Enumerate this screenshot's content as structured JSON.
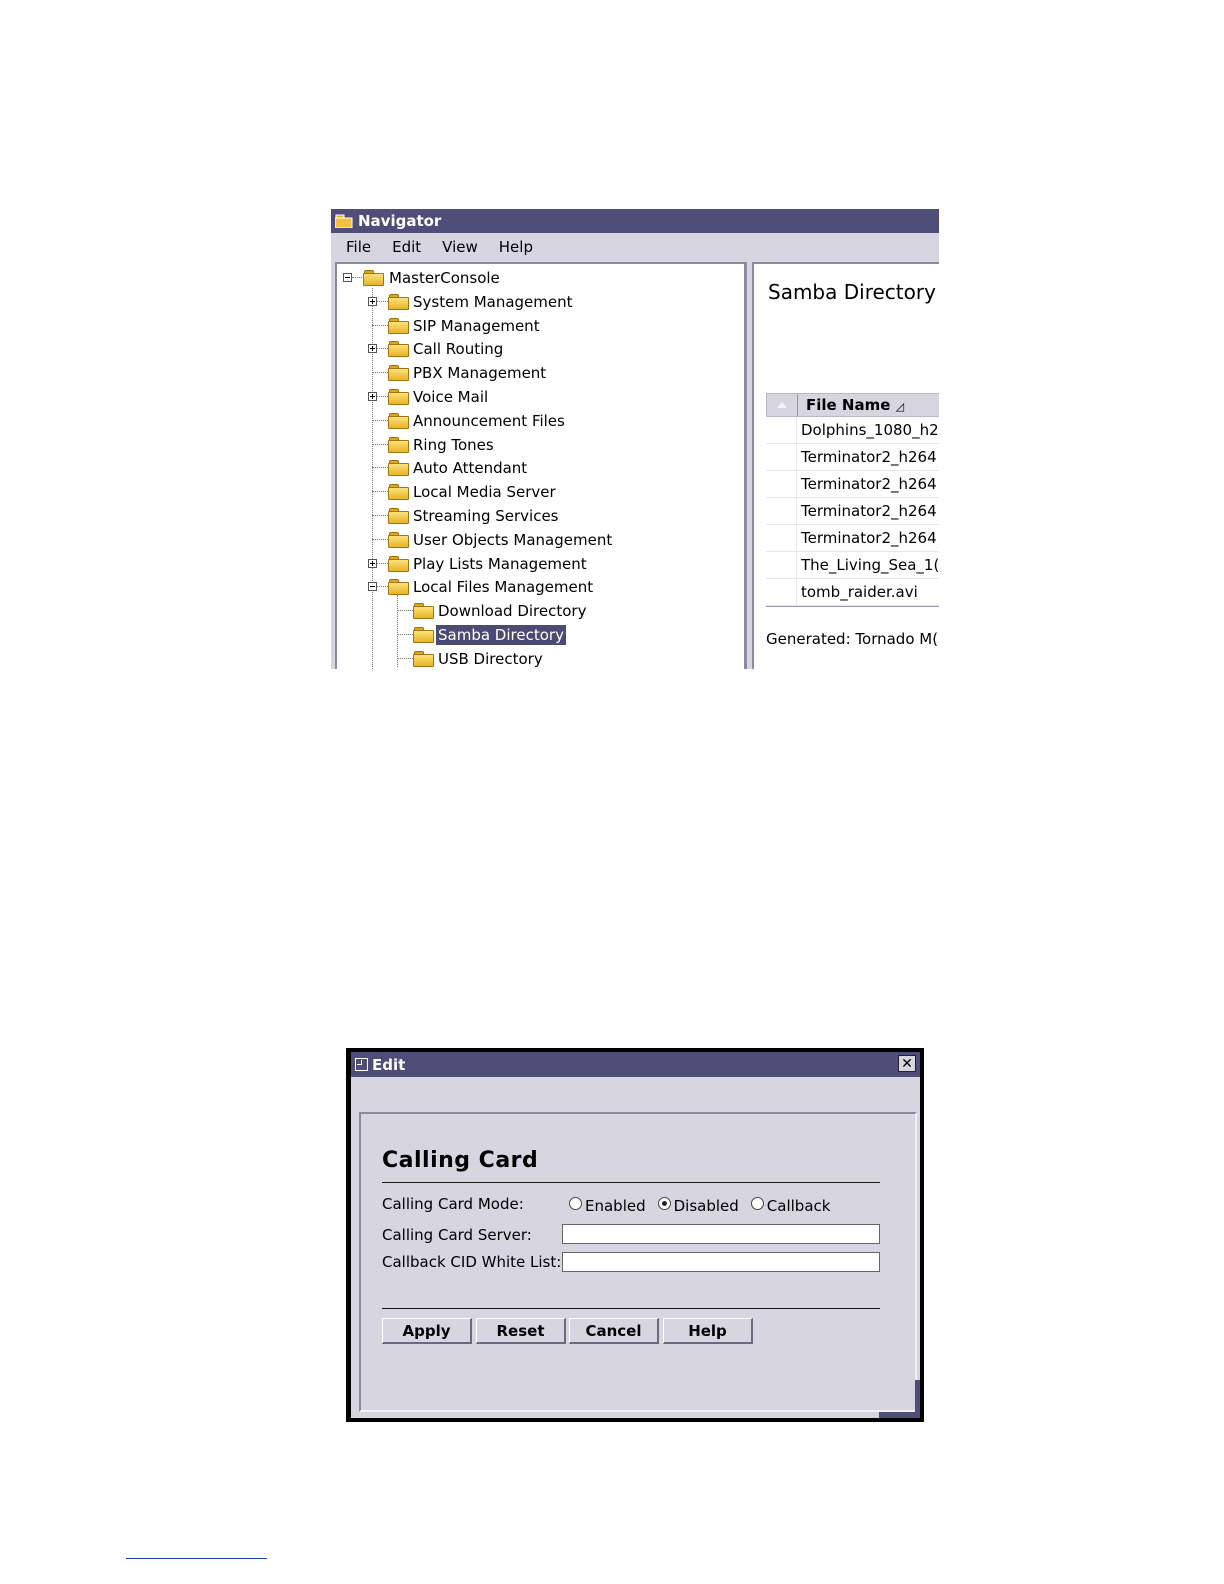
{
  "navigator": {
    "title": "Navigator",
    "menu": [
      "File",
      "Edit",
      "View",
      "Help"
    ],
    "tree": {
      "root": "MasterConsole",
      "items": [
        {
          "label": "System Management",
          "expandable": true
        },
        {
          "label": "SIP Management",
          "expandable": false
        },
        {
          "label": "Call Routing",
          "expandable": true
        },
        {
          "label": "PBX Management",
          "expandable": false
        },
        {
          "label": "Voice Mail",
          "expandable": true
        },
        {
          "label": "Announcement Files",
          "expandable": false
        },
        {
          "label": "Ring Tones",
          "expandable": false
        },
        {
          "label": "Auto Attendant",
          "expandable": false
        },
        {
          "label": "Local Media Server",
          "expandable": false
        },
        {
          "label": "Streaming Services",
          "expandable": false
        },
        {
          "label": "User Objects Management",
          "expandable": false
        },
        {
          "label": "Play Lists Management",
          "expandable": true
        },
        {
          "label": "Local Files Management",
          "expanded": true
        }
      ],
      "children": [
        {
          "label": "Download Directory"
        },
        {
          "label": "Samba Directory",
          "selected": true
        },
        {
          "label": "USB Directory"
        }
      ]
    },
    "content": {
      "title": "Samba Directory",
      "column_header": "File Name",
      "sort_indicator": "▲",
      "files": [
        "Dolphins_1080_h2",
        "Terminator2_h264",
        "Terminator2_h264",
        "Terminator2_h264",
        "Terminator2_h264",
        "The_Living_Sea_1(",
        "tomb_raider.avi"
      ],
      "generated": "Generated: Tornado M("
    }
  },
  "edit_dialog": {
    "title": "Edit",
    "close_glyph": "✕",
    "heading": "Calling Card",
    "mode_label": "Calling Card Mode:",
    "mode_options": [
      "Enabled",
      "Disabled",
      "Callback"
    ],
    "mode_selected": "Disabled",
    "server_label": "Calling Card Server:",
    "server_value": "",
    "whitelist_label": "Callback CID White List:",
    "whitelist_value": "",
    "buttons": [
      "Apply",
      "Reset",
      "Cancel",
      "Help"
    ]
  },
  "colors": {
    "titlebar": "#4f4e78",
    "window_bg": "#d6d5e0",
    "selection": "#4a4a72",
    "folder": "#f0c040"
  }
}
